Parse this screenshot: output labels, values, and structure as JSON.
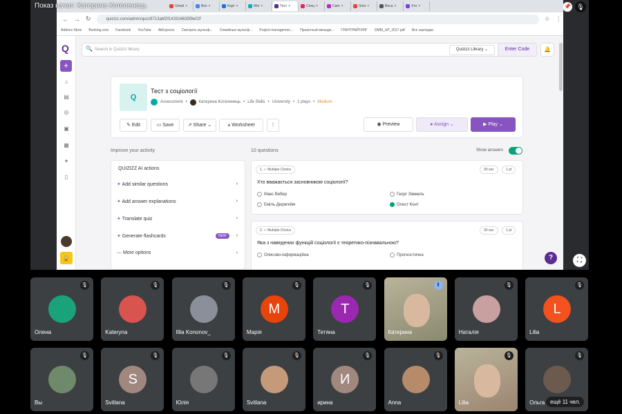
{
  "meet": {
    "presenting_label": "Показ начат: Катерина Котеленець",
    "more_participants": "ещё 11 чел.",
    "colors": {
      "tile": "#3c4043",
      "bg": "#000000"
    }
  },
  "browser": {
    "tabs": [
      "Gmail",
      "Вхо",
      "Карт",
      "Мої",
      "Тест",
      "Спец",
      "Сam",
      "Smo",
      "Веса",
      "Хто"
    ],
    "url": "quizizz.com/admin/quiz/6713abf2f143316635f9e02f",
    "bookmarks": [
      "Addons Store",
      "Booking.com",
      "Facebook",
      "YouTube",
      "AliExpress",
      "Смотреть мультф...",
      "Семейные мультф...",
      "Project managemen...",
      "Проектный менедж...",
      "ГРАНТРАЙТИНГ",
      "DMM_UP_2017.pdf",
      "Все закладки"
    ]
  },
  "quizizz": {
    "search_placeholder": "Search in Quizizz library",
    "library_select": "Quizizz Library",
    "enter_code": "Enter Code",
    "accent": "#8854c0",
    "quiz": {
      "title": "Тест з соціології",
      "type": "Assessment",
      "author": "Катерина Котеленець",
      "subject": "Life Skills",
      "level": "University",
      "plays": "1 plays",
      "difficulty": "Medium"
    },
    "actions": {
      "edit": "Edit",
      "save": "Save",
      "share": "Share",
      "worksheet": "Worksheet",
      "more": "⋮",
      "preview": "Preview",
      "assign": "Assign",
      "play": "Play"
    },
    "improve_label": "Improve your activity",
    "ai_title": "QUIZIZZ AI actions",
    "ai_items": [
      "Add similar questions",
      "Add answer explanations",
      "Translate quiz",
      "Generate flashcards",
      "More options"
    ],
    "new_badge": "NEW",
    "questions_count": "10 questions",
    "show_answers": "Show answers",
    "show_answers_on": true,
    "questions": [
      {
        "label": "1. ✓ Multiple Choice",
        "time": "30 sec",
        "points": "1 pt",
        "text": "Хто вважається засновником соціології?",
        "options": [
          {
            "t": "Макс Вебер",
            "ok": false
          },
          {
            "t": "Георг Зіммель",
            "ok": false
          },
          {
            "t": "Еміль Дюркгейм",
            "ok": false
          },
          {
            "t": "Огюст Конт",
            "ok": true
          }
        ]
      },
      {
        "label": "2. ✓ Multiple Choice",
        "time": "30 sec",
        "points": "1 pt",
        "text": "Яка з наведених функцій соціології є теоретико-пізнавальною?",
        "options": [
          {
            "t": "Описово-інформаційна",
            "ok": false
          },
          {
            "t": "Прогностична",
            "ok": false
          }
        ]
      }
    ],
    "help": "?"
  },
  "participants": [
    {
      "name": "Олена",
      "initial": "",
      "color": "#1aa37a"
    },
    {
      "name": "Kateryna",
      "initial": "",
      "color": "#d9534f"
    },
    {
      "name": "Illia Kononov_",
      "initial": "",
      "color": "#8a8f99"
    },
    {
      "name": "Марія",
      "initial": "M",
      "color": "#e8430a"
    },
    {
      "name": "Тетяна",
      "initial": "T",
      "color": "#9c27b0"
    },
    {
      "name": "Катерина",
      "initial": "",
      "color": "#8a8a70",
      "video": true
    },
    {
      "name": "Наталія",
      "initial": "",
      "color": "#c9a0a0"
    },
    {
      "name": "Lilia",
      "initial": "L",
      "color": "#f4511e"
    },
    {
      "name": "Вы",
      "initial": "",
      "color": "#6f8a6a"
    },
    {
      "name": "Svitlana",
      "initial": "S",
      "color": "#a1887f"
    },
    {
      "name": "Юлія",
      "initial": "",
      "color": "#777"
    },
    {
      "name": "Svitlana",
      "initial": "",
      "color": "#c49a7a"
    },
    {
      "name": "ирина",
      "initial": "И",
      "color": "#a1887f"
    },
    {
      "name": "Anna",
      "initial": "",
      "color": "#b58b6a"
    },
    {
      "name": "Lilia",
      "initial": "",
      "color": "#9b8570",
      "video": true
    },
    {
      "name": "Ольга",
      "initial": "",
      "color": "#6d5a4f"
    }
  ]
}
